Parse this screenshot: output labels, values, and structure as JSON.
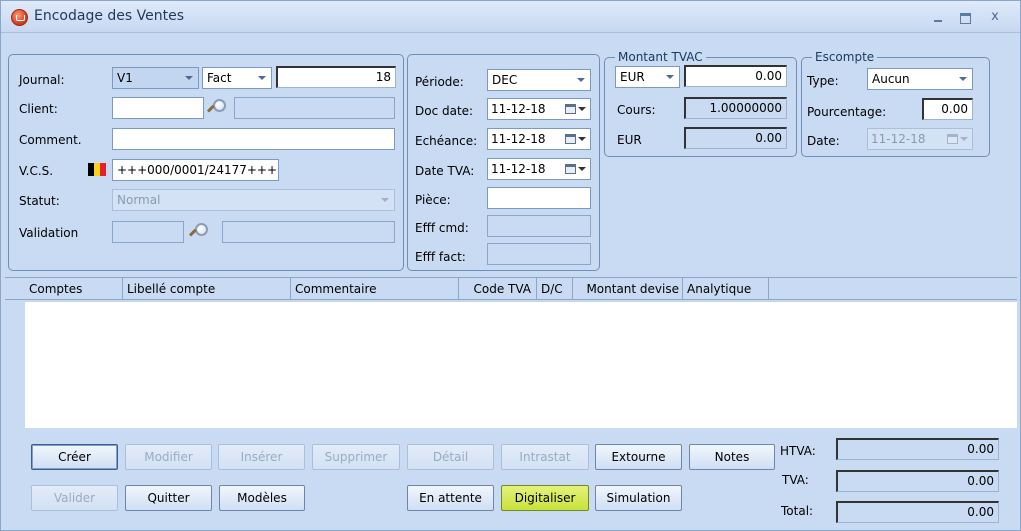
{
  "window": {
    "title": "Encodage des Ventes",
    "close_glyph": "x"
  },
  "header": {
    "journal_label": "Journal:",
    "journal_value": "V1",
    "type_value": "Fact",
    "number_value": "18",
    "client_label": "Client:",
    "client_value": "",
    "client_name": "",
    "comment_label": "Comment.",
    "comment_value": "",
    "vcs_label": "V.C.S.",
    "vcs_value": "+++000/0001/24177+++",
    "statut_label": "Statut:",
    "statut_value": "Normal",
    "validation_label": "Validation"
  },
  "dates": {
    "periode_label": "Période:",
    "periode_value": "DEC",
    "docdate_label": "Doc date:",
    "docdate_value": "11-12-18",
    "echeance_label": "Echéance:",
    "echeance_value": "11-12-18",
    "datetva_label": "Date TVA:",
    "datetva_value": "11-12-18",
    "piece_label": "Pièce:",
    "piece_value": "",
    "effcmd_label": "Efff cmd:",
    "efffact_label": "Efff fact:"
  },
  "montant": {
    "legend": "Montant TVAC",
    "currency_value": "EUR",
    "amount_value": "0.00",
    "cours_label": "Cours:",
    "cours_value": "1.00000000",
    "eur_label": "EUR",
    "eur_value": "0.00"
  },
  "escompte": {
    "legend": "Escompte",
    "type_label": "Type:",
    "type_value": "Aucun",
    "pourcentage_label": "Pourcentage:",
    "pourcentage_value": "0.00",
    "date_label": "Date:",
    "date_value": "11-12-18"
  },
  "grid": {
    "columns": [
      "Comptes",
      "Libellé compte",
      "Commentaire",
      "Code TVA",
      "D/C",
      "Montant devise",
      "Analytique"
    ]
  },
  "buttons": {
    "creer": "Créer",
    "modifier": "Modifier",
    "inserer": "Insérer",
    "supprimer": "Supprimer",
    "detail": "Détail",
    "intrastat": "Intrastat",
    "extourne": "Extourne",
    "notes": "Notes",
    "valider": "Valider",
    "quitter": "Quitter",
    "modeles": "Modèles",
    "en_attente": "En attente",
    "digitaliser": "Digitaliser",
    "simulation": "Simulation"
  },
  "totals": {
    "htva_label": "HTVA:",
    "htva_value": "0.00",
    "tva_label": "TVA:",
    "tva_value": "0.00",
    "total_label": "Total:",
    "total_value": "0.00"
  },
  "colors": {
    "window_bg": "#c9dbf2",
    "highlight_button": "#c9e23a",
    "flag": [
      "#000000",
      "#f7d21b",
      "#e5202b"
    ]
  }
}
